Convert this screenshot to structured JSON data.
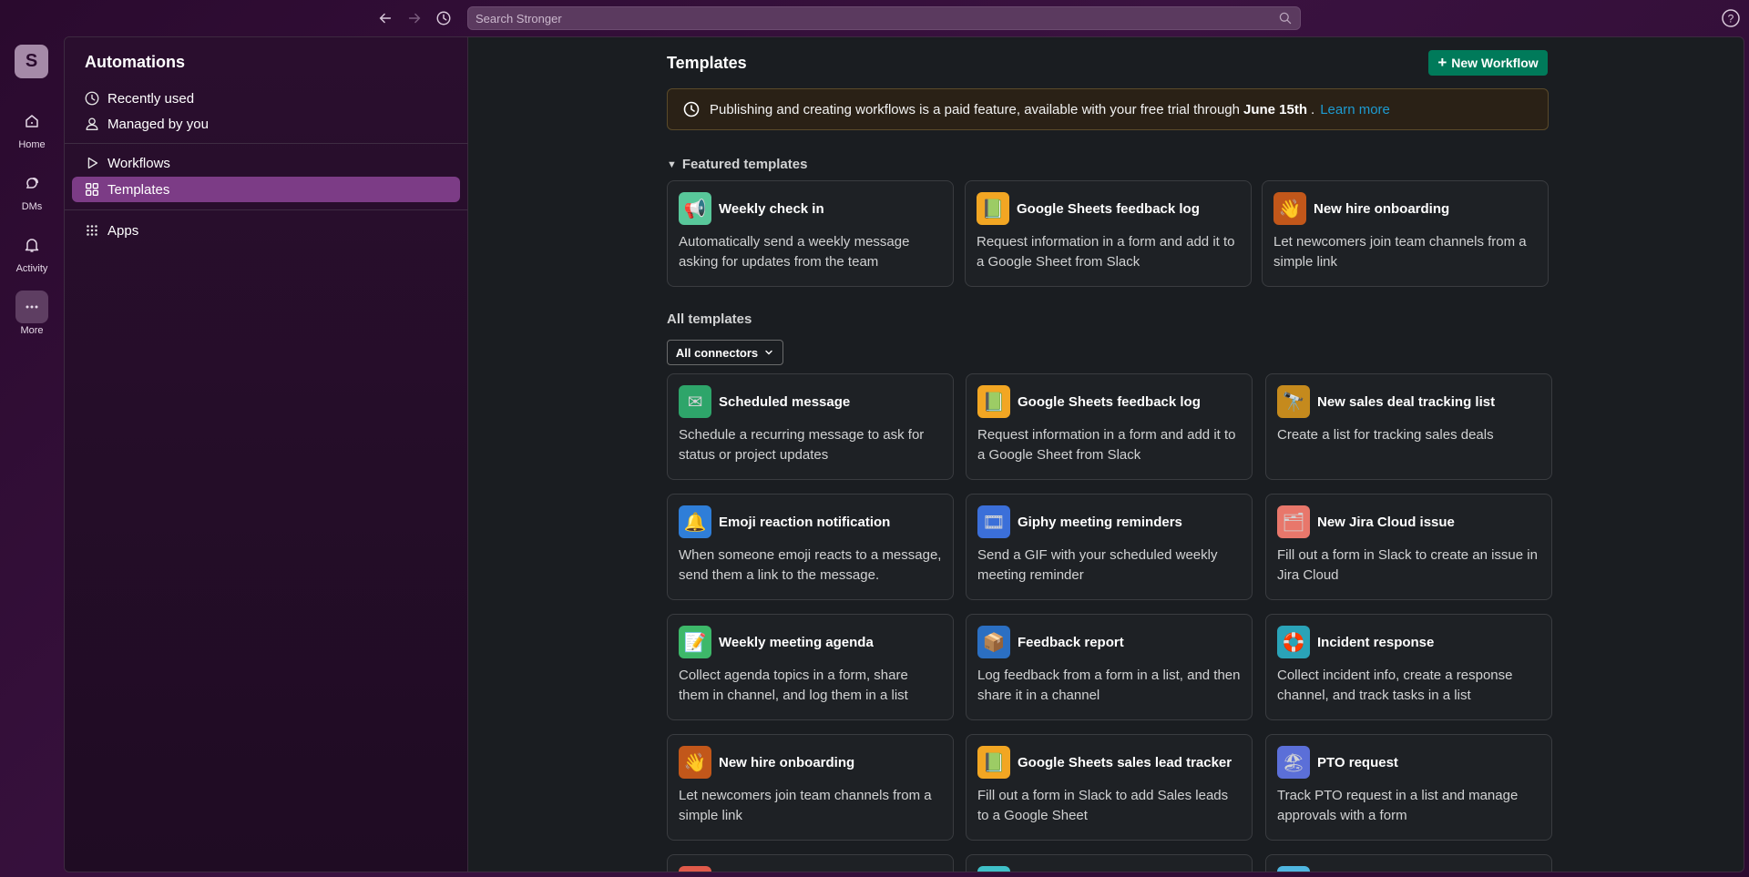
{
  "search": {
    "placeholder": "Search Stronger"
  },
  "rail": {
    "workspace_initial": "S",
    "items": [
      {
        "label": "Home",
        "icon": "home-icon"
      },
      {
        "label": "DMs",
        "icon": "dms-icon"
      },
      {
        "label": "Activity",
        "icon": "bell-icon"
      },
      {
        "label": "More",
        "icon": "ellipsis-icon"
      }
    ]
  },
  "sidebar": {
    "title": "Automations",
    "items": [
      {
        "label": "Recently used",
        "icon": "clock-icon"
      },
      {
        "label": "Managed by you",
        "icon": "person-icon"
      },
      {
        "label": "Workflows",
        "icon": "play-icon"
      },
      {
        "label": "Templates",
        "icon": "grid-icon",
        "active": true
      },
      {
        "label": "Apps",
        "icon": "apps-icon"
      }
    ]
  },
  "main": {
    "title": "Templates",
    "new_workflow_label": "New Workflow",
    "banner": {
      "text_before": "Publishing and creating workflows is a paid feature, available with your free trial through",
      "date": "June 15th",
      "after": ".",
      "link": "Learn more"
    },
    "featured_heading": "Featured templates",
    "featured": [
      {
        "title": "Weekly check in",
        "desc": "Automatically send a weekly message asking for updates from the team",
        "icon": "megaphone-icon",
        "emoji": "📢",
        "color": "#58c79a"
      },
      {
        "title": "Google Sheets feedback log",
        "desc": "Request information in a form and add it to a Google Sheet from Slack",
        "icon": "sheets-icon",
        "emoji": "📗",
        "color": "#f2a623"
      },
      {
        "title": "New hire onboarding",
        "desc": "Let newcomers join team channels from a simple link",
        "icon": "wave-icon",
        "emoji": "👋",
        "color": "#c2571a"
      }
    ],
    "all_heading": "All templates",
    "connectors_label": "All connectors",
    "all": [
      {
        "title": "Scheduled message",
        "desc": "Schedule a recurring message to ask for status or project updates",
        "icon": "paper-plane-icon",
        "emoji": "✉",
        "color": "#2ea56a"
      },
      {
        "title": "Google Sheets feedback log",
        "desc": "Request information in a form and add it to a Google Sheet from Slack",
        "icon": "sheets-icon",
        "emoji": "📗",
        "color": "#f2a623"
      },
      {
        "title": "New sales deal tracking list",
        "desc": "Create a list for tracking sales deals",
        "icon": "telescope-icon",
        "emoji": "🔭",
        "color": "#c58a1d"
      },
      {
        "title": "Emoji reaction notification",
        "desc": "When someone emoji reacts to a message, send them a link to the message.",
        "icon": "bell-icon",
        "emoji": "🔔",
        "color": "#2f7ed8"
      },
      {
        "title": "Giphy meeting reminders",
        "desc": "Send a GIF with your scheduled weekly meeting reminder",
        "icon": "giphy-icon",
        "emoji": "🎞",
        "color": "#3b6fd9"
      },
      {
        "title": "New Jira Cloud issue",
        "desc": "Fill out a form in Slack to create an issue in Jira Cloud",
        "icon": "jira-icon",
        "emoji": "🗂",
        "color": "#e8776b"
      },
      {
        "title": "Weekly meeting agenda",
        "desc": "Collect agenda topics in a form, share them in channel, and log them in a list",
        "icon": "agenda-icon",
        "emoji": "📝",
        "color": "#3db869"
      },
      {
        "title": "Feedback report",
        "desc": "Log feedback from a form in a list, and then share it in a channel",
        "icon": "box-icon",
        "emoji": "📦",
        "color": "#2b6fc2"
      },
      {
        "title": "Incident response",
        "desc": "Collect incident info, create a response channel, and track tasks in a list",
        "icon": "lifebuoy-icon",
        "emoji": "🛟",
        "color": "#2aa3b8"
      },
      {
        "title": "New hire onboarding",
        "desc": "Let newcomers join team channels from a simple link",
        "icon": "wave-icon",
        "emoji": "👋",
        "color": "#c2571a"
      },
      {
        "title": "Google Sheets sales lead tracker",
        "desc": "Fill out a form in Slack to add Sales leads to a Google Sheet",
        "icon": "sheets-icon",
        "emoji": "📗",
        "color": "#f2a623"
      },
      {
        "title": "PTO request",
        "desc": "Track PTO request in a list and manage approvals with a form",
        "icon": "beach-icon",
        "emoji": "🏖",
        "color": "#5b6fd8"
      }
    ],
    "peek_colors": [
      "#e05a4a",
      "#3fc0c8",
      "#4fb6e0"
    ]
  }
}
